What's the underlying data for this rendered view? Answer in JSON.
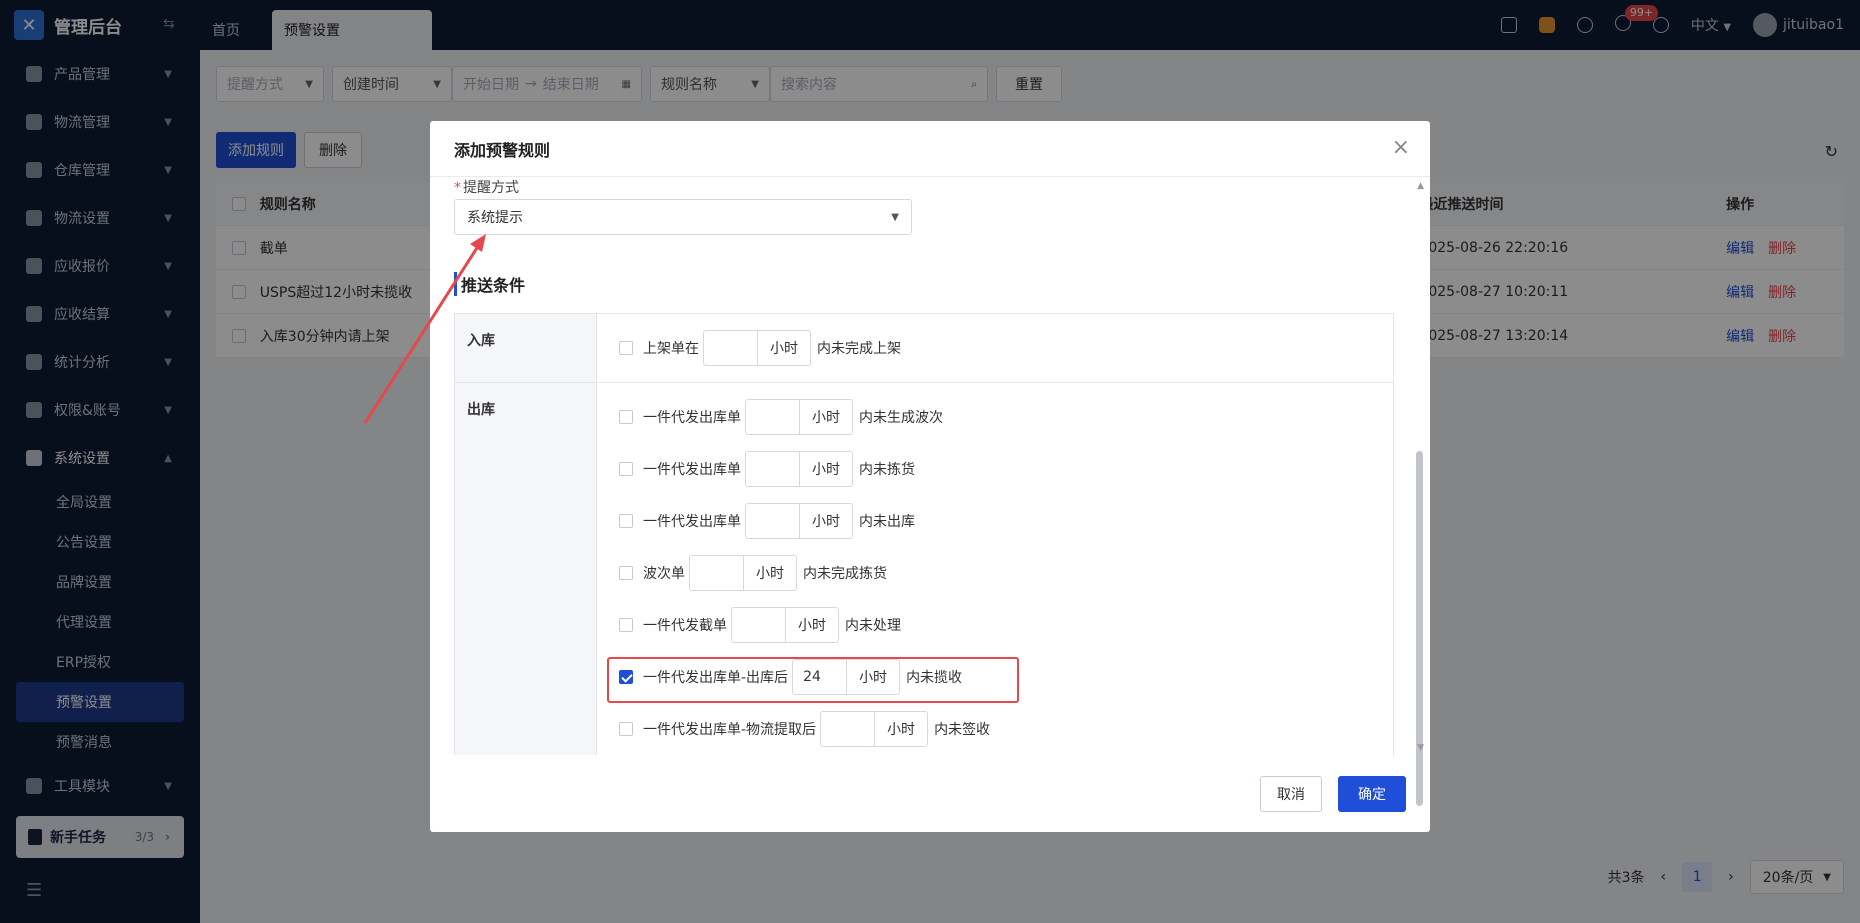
{
  "app": {
    "title": "管理后台"
  },
  "tabs": [
    {
      "label": "首页"
    },
    {
      "label": "预警设置"
    }
  ],
  "topbar": {
    "badge": "99+",
    "language": "中文",
    "user": "jituibao1"
  },
  "sidebar": {
    "items": [
      {
        "label": "产品管理"
      },
      {
        "label": "物流管理"
      },
      {
        "label": "仓库管理"
      },
      {
        "label": "物流设置"
      },
      {
        "label": "应收报价"
      },
      {
        "label": "应收结算"
      },
      {
        "label": "统计分析"
      },
      {
        "label": "权限&账号"
      },
      {
        "label": "系统设置"
      }
    ],
    "sub_items": [
      {
        "label": "全局设置"
      },
      {
        "label": "公告设置"
      },
      {
        "label": "品牌设置"
      },
      {
        "label": "代理设置"
      },
      {
        "label": "ERP授权"
      },
      {
        "label": "预警设置"
      },
      {
        "label": "预警消息"
      }
    ],
    "tools": {
      "label": "工具模块"
    },
    "novice": {
      "label": "新手任务",
      "count": "3/3"
    }
  },
  "filters": {
    "method": "提醒方式",
    "time_type": "创建时间",
    "start_date": "开始日期",
    "end_date": "结束日期",
    "search_type": "规则名称",
    "search_placeholder": "搜索内容",
    "reset": "重置"
  },
  "actions": {
    "add": "添加规则",
    "delete": "删除"
  },
  "table": {
    "headers": {
      "name": "规则名称",
      "last_push": "最近推送时间",
      "ops": "操作"
    },
    "rows": [
      {
        "name": "截单",
        "time": "2025-08-26 22:20:16"
      },
      {
        "name": "USPS超过12小时未揽收",
        "time": "2025-08-27 10:20:11"
      },
      {
        "name": "入库30分钟内请上架",
        "time": "2025-08-27 13:20:14"
      }
    ],
    "edit": "编辑",
    "delete": "删除"
  },
  "pagination": {
    "total": "共3条",
    "page": "1",
    "size": "20条/页"
  },
  "modal": {
    "title": "添加预警规则",
    "method_label": "提醒方式",
    "method_value": "系统提示",
    "section_title": "推送条件",
    "unit": "小时",
    "groups": [
      {
        "label": "入库",
        "rows": [
          {
            "prefix": "上架单在",
            "value": "",
            "suffix": "内未完成上架",
            "checked": false
          }
        ]
      },
      {
        "label": "出库",
        "rows": [
          {
            "prefix": "一件代发出库单",
            "value": "",
            "suffix": "内未生成波次",
            "checked": false
          },
          {
            "prefix": "一件代发出库单",
            "value": "",
            "suffix": "内未拣货",
            "checked": false
          },
          {
            "prefix": "一件代发出库单",
            "value": "",
            "suffix": "内未出库",
            "checked": false
          },
          {
            "prefix": "波次单",
            "value": "",
            "suffix": "内未完成拣货",
            "checked": false
          },
          {
            "prefix": "一件代发截单",
            "value": "",
            "suffix": "内未处理",
            "checked": false
          },
          {
            "prefix": "一件代发出库单-出库后",
            "value": "24",
            "suffix": "内未揽收",
            "checked": true
          },
          {
            "prefix": "一件代发出库单-物流提取后",
            "value": "",
            "suffix": "内未签收",
            "checked": false
          }
        ]
      }
    ],
    "cancel": "取消",
    "ok": "确定"
  },
  "colors": {
    "primary": "#1f4ed8",
    "sidebar": "#0e1a33",
    "danger": "#e5484d"
  }
}
